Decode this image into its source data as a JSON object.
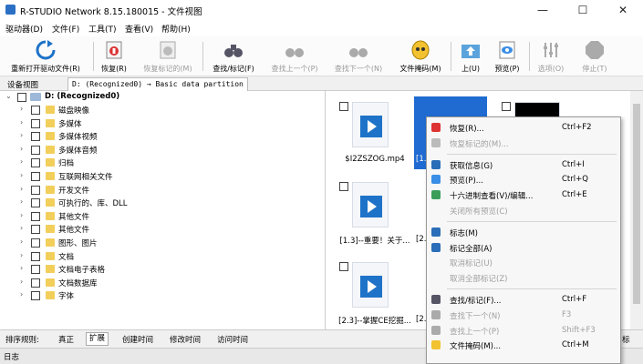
{
  "window": {
    "title": "R-STUDIO Network 8.15.180015 - 文件视图",
    "minimize": "—",
    "maximize": "☐",
    "close": "✕"
  },
  "menu": [
    "驱动器(D)",
    "文件(F)",
    "工具(T)",
    "查看(V)",
    "帮助(H)"
  ],
  "toolbar": [
    {
      "label": "重新打开驱动文件(R)",
      "icon": "refresh-icon",
      "enabled": true
    },
    {
      "label": "恢复(R)",
      "icon": "recover-icon",
      "enabled": true
    },
    {
      "label": "恢复标记的(M)",
      "icon": "recover-marked-icon",
      "enabled": false
    },
    {
      "label": "查找/标记(F)",
      "icon": "binoculars-icon",
      "enabled": true
    },
    {
      "label": "查找上一个(P)",
      "icon": "find-prev-icon",
      "enabled": false
    },
    {
      "label": "查找下一个(N)",
      "icon": "find-next-icon",
      "enabled": false
    },
    {
      "label": "文件掩码(M)",
      "icon": "file-mask-icon",
      "enabled": true
    },
    {
      "label": "上(U)",
      "icon": "up-folder-icon",
      "enabled": true
    },
    {
      "label": "预览(P)",
      "icon": "preview-icon",
      "enabled": true
    },
    {
      "label": "选项(O)",
      "icon": "options-icon",
      "enabled": false
    },
    {
      "label": "停止(T)",
      "icon": "stop-icon",
      "enabled": false
    }
  ],
  "tabs": [
    "设备视图",
    "D: (Recognized0) → Basic data partition"
  ],
  "tree": {
    "root": "D: (Recognized0)",
    "items": [
      "磁盘映像",
      "多媒体",
      "多媒体视频",
      "多媒体音频",
      "归档",
      "互联网相关文件",
      "开发文件",
      "可执行的、库、DLL",
      "其他文件",
      "其他文件",
      "图形、图片",
      "文档",
      "文档电子表格",
      "文档数据库",
      "字体"
    ]
  },
  "files": [
    {
      "name": "$I2ZSZOG.mp4",
      "selected": false
    },
    {
      "name": "[1...",
      "selected": true
    },
    {
      "name": "",
      "selected": false
    },
    {
      "name": "[1.3]--重要！关于...",
      "selected": false
    },
    {
      "name": "[2...",
      "selected": false
    },
    {
      "name": "[2.3]--掌握CE挖掘...",
      "selected": false
    },
    {
      "name": "[2...",
      "selected": false
    }
  ],
  "sortbar": {
    "label": "排序规则:",
    "items": [
      "真正",
      "扩展",
      "创建时间",
      "修改时间",
      "访问时间"
    ],
    "active": 1,
    "right": "标"
  },
  "log": "日志",
  "context_menu": [
    {
      "label": "恢复(R)...",
      "shortcut": "Ctrl+F2",
      "enabled": true,
      "icon": "recover-icon"
    },
    {
      "label": "恢复标记的(M)...",
      "shortcut": "",
      "enabled": false,
      "icon": "recover-marked-icon"
    },
    {
      "sep": true
    },
    {
      "label": "获取信息(G)",
      "shortcut": "Ctrl+I",
      "enabled": true,
      "icon": "info-icon"
    },
    {
      "label": "预览(P)...",
      "shortcut": "Ctrl+Q",
      "enabled": true,
      "icon": "preview-icon"
    },
    {
      "label": "十六进制查看(V)/编辑...",
      "shortcut": "Ctrl+E",
      "enabled": true,
      "icon": "hex-icon"
    },
    {
      "label": "关闭所有预览(C)",
      "shortcut": "",
      "enabled": false,
      "icon": ""
    },
    {
      "sep": true
    },
    {
      "label": "标志(M)",
      "shortcut": "",
      "enabled": true,
      "icon": "check-icon"
    },
    {
      "label": "标记全部(A)",
      "shortcut": "",
      "enabled": true,
      "icon": "check-all-icon"
    },
    {
      "label": "取消标记(U)",
      "shortcut": "",
      "enabled": false,
      "icon": ""
    },
    {
      "label": "取消全部标记(Z)",
      "shortcut": "",
      "enabled": false,
      "icon": ""
    },
    {
      "sep": true
    },
    {
      "label": "查找/标记(F)...",
      "shortcut": "Ctrl+F",
      "enabled": true,
      "icon": "binoculars-icon"
    },
    {
      "label": "查找下一个(N)",
      "shortcut": "F3",
      "enabled": false,
      "icon": "find-next-icon"
    },
    {
      "label": "查找上一个(P)",
      "shortcut": "Shift+F3",
      "enabled": false,
      "icon": "find-prev-icon"
    },
    {
      "label": "文件掩码(M)...",
      "shortcut": "Ctrl+M",
      "enabled": true,
      "icon": "file-mask-icon"
    }
  ],
  "colors": {
    "accent": "#1f6bd1",
    "folder": "#f2cf5b"
  }
}
